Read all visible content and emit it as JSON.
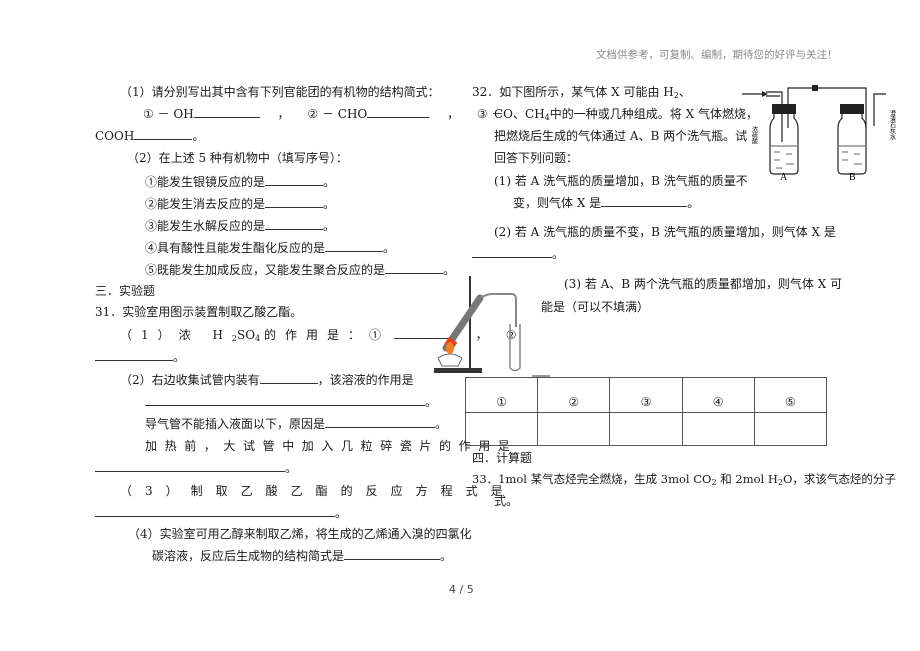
{
  "header_note": "文档供参考，可复制、编制，期待您的好评与关注！",
  "left": {
    "q1_intro": "（1）请分别写出其中含有下列官能团的有机物的结构简式：",
    "q1_items": [
      "① － OH",
      "② － CHO",
      "③ －"
    ],
    "q1_item3_cont": "COOH",
    "q2_intro": "（2）在上述 5 种有机物中（填写序号）：",
    "q2_items": [
      "①能发生银镜反应的是",
      "②能发生消去反应的是",
      "③能发生水解反应的是",
      "④具有酸性且能发生酯化反应的是",
      "⑤既能发生加成反应，又能发生聚合反应的是"
    ],
    "section3": "三．实验题",
    "q31": "31．实验室用图示装置制取乙酸乙酯。",
    "q31_1_prefix": "（1）浓 H",
    "q31_1_sub": "2",
    "q31_1_mid": "SO",
    "q31_1_sub2": "4",
    "q31_1_suffix": "的作用是：①",
    "q31_1_circle2": "②",
    "q31_2_a": "（2）右边收集试管内装有",
    "q31_2_b": "，该溶液的作用是",
    "q31_2_c": "导气管不能插入液面以下，原因是",
    "q31_2_d": "加热前，大试管中加入几粒碎瓷片的作用是",
    "q31_3": "（3）制取乙酸乙酯的反应方程式是",
    "q31_4_a": "（4）实验室可用乙醇来制取乙烯，将生成的乙烯通入溴的四氯化",
    "q31_4_b": "碳溶液，反应后生成物的结构简式是",
    "period": "。",
    "comma": "，"
  },
  "right": {
    "q32_line1": "32．如下图所示，某气体 X 可能由 H",
    "q32_line1_sub": "2",
    "q32_line1_end": "、",
    "q32_line2_a": "CO、CH",
    "q32_line2_sub": "4",
    "q32_line2_b": "中的一种或几种组成。将 X 气体燃烧，",
    "q32_line3": "把燃烧后生成的气体通过 A、B 两个洗气瓶。试",
    "q32_line4": "回答下列问题：",
    "q32_1_a": "(1) 若 A 洗气瓶的质量增加，B 洗气瓶的质量不",
    "q32_1_b": "变，则气体 X 是",
    "q32_2": "(2) 若 A 洗气瓶的质量不变，B 洗气瓶的质量增加，则气体 X 是",
    "q32_3_a": "(3) 若 A、B 两个洗气瓶的质量都增加，则气体 X 可",
    "q32_3_b": "能是（可以不填满）",
    "table_headers": [
      "①",
      "②",
      "③",
      "④",
      "⑤"
    ],
    "table_values": [
      "",
      "",
      "",
      "",
      ""
    ],
    "section4": "四．计算题",
    "q33_a": "33．1mol 某气态烃完全燃烧，生成 3mol CO",
    "q33_sub1": "2",
    "q33_b": " 和 2mol H",
    "q33_sub2": "2",
    "q33_c": "O，求该气态烃的分子",
    "q33_d": "式。",
    "figure_labels": {
      "bottle_a": "A",
      "bottle_b": "B",
      "reagent_a": "浓硫酸",
      "reagent_b": "澄清石灰水"
    }
  },
  "footer": {
    "page": "4 / 5"
  }
}
